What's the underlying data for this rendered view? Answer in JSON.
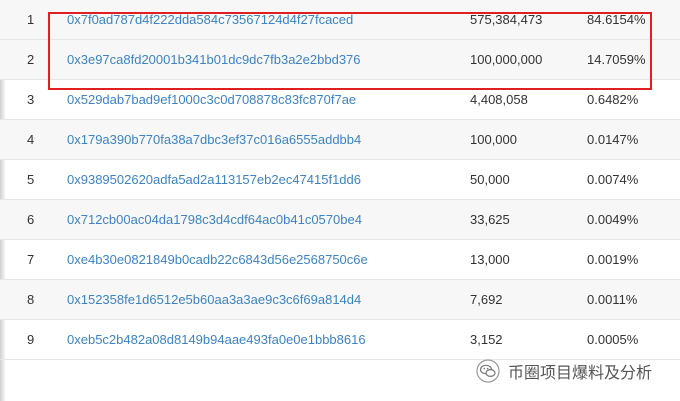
{
  "holders": [
    {
      "rank": "1",
      "address": "0x7f0ad787d4f222dda584c73567124d4f27fcaced",
      "quantity": "575,384,473",
      "percent": "84.6154%"
    },
    {
      "rank": "2",
      "address": "0x3e97ca8fd20001b341b01dc9dc7fb3a2e2bbd376",
      "quantity": "100,000,000",
      "percent": "14.7059%"
    },
    {
      "rank": "3",
      "address": "0x529dab7bad9ef1000c3c0d708878c83fc870f7ae",
      "quantity": "4,408,058",
      "percent": "0.6482%"
    },
    {
      "rank": "4",
      "address": "0x179a390b770fa38a7dbc3ef37c016a6555addbb4",
      "quantity": "100,000",
      "percent": "0.0147%"
    },
    {
      "rank": "5",
      "address": "0x9389502620adfa5ad2a113157eb2ec47415f1dd6",
      "quantity": "50,000",
      "percent": "0.0074%"
    },
    {
      "rank": "6",
      "address": "0x712cb00ac04da1798c3d4cdf64ac0b41c0570be4",
      "quantity": "33,625",
      "percent": "0.0049%"
    },
    {
      "rank": "7",
      "address": "0xe4b30e0821849b0cadb22c6843d56e2568750c6e",
      "quantity": "13,000",
      "percent": "0.0019%"
    },
    {
      "rank": "8",
      "address": "0x152358fe1d6512e5b60aa3a3ae9c3c6f69a814d4",
      "quantity": "7,692",
      "percent": "0.0011%"
    },
    {
      "rank": "9",
      "address": "0xeb5c2b482a08d8149b94aae493fa0e0e1bbb8616",
      "quantity": "3,152",
      "percent": "0.0005%"
    }
  ],
  "watermark": {
    "text": "币圈项目爆料及分析",
    "icon": "wechat-icon"
  },
  "colors": {
    "link": "#3c84c6",
    "highlight": "#e02020",
    "row_alt": "#f7f7f7"
  }
}
